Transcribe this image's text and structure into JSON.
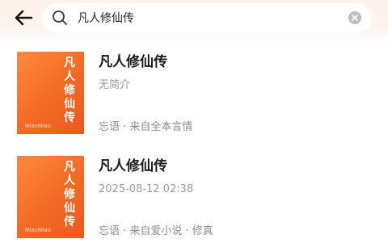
{
  "search": {
    "value": "凡人修仙传",
    "accent_color": "#f26a24"
  },
  "results": [
    {
      "cover": {
        "title": "凡人修仙传",
        "brand": "MiaoMiao"
      },
      "title": "凡人修仙传",
      "subtitle": "无简介",
      "meta": "忘语 · 来自全本言情"
    },
    {
      "cover": {
        "title": "凡人修仙传",
        "brand": "MiaoMiao"
      },
      "title": "凡人修仙传",
      "subtitle": "2025-08-12 02:38",
      "meta": "忘语 · 来自爱小说 · 修真"
    }
  ]
}
